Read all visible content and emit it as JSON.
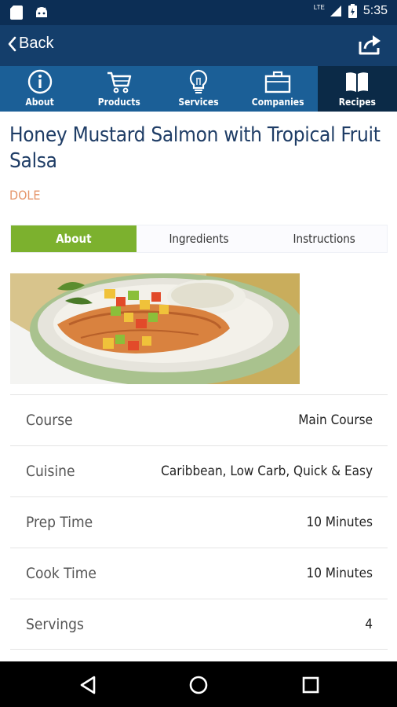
{
  "status_bar": {
    "network_label": "LTE",
    "time": "5:35"
  },
  "app_bar": {
    "back_label": "Back"
  },
  "tabs": [
    {
      "label": "About",
      "icon": "info-icon"
    },
    {
      "label": "Products",
      "icon": "cart-icon"
    },
    {
      "label": "Services",
      "icon": "lightbulb-icon"
    },
    {
      "label": "Companies",
      "icon": "briefcase-icon"
    },
    {
      "label": "Recipes",
      "icon": "book-icon",
      "active": true
    }
  ],
  "recipe": {
    "title": "Honey Mustard Salmon with Tropical Fruit Salsa",
    "brand": "DOLE"
  },
  "segments": [
    {
      "label": "About",
      "active": true
    },
    {
      "label": "Ingredients",
      "active": false
    },
    {
      "label": "Instructions",
      "active": false
    }
  ],
  "details": [
    {
      "label": "Course",
      "value": "Main Course"
    },
    {
      "label": "Cuisine",
      "value": "Caribbean, Low Carb, Quick & Easy"
    },
    {
      "label": "Prep Time",
      "value": "10 Minutes"
    },
    {
      "label": "Cook Time",
      "value": "10 Minutes"
    },
    {
      "label": "Servings",
      "value": "4"
    }
  ],
  "colors": {
    "status_bar": "#0c2e55",
    "app_bar": "#143e6b",
    "tab_bar": "#1b5f97",
    "tab_active": "#0b2a47",
    "title": "#1f3d66",
    "brand": "#e5956a",
    "segment_active": "#7cb12e"
  }
}
